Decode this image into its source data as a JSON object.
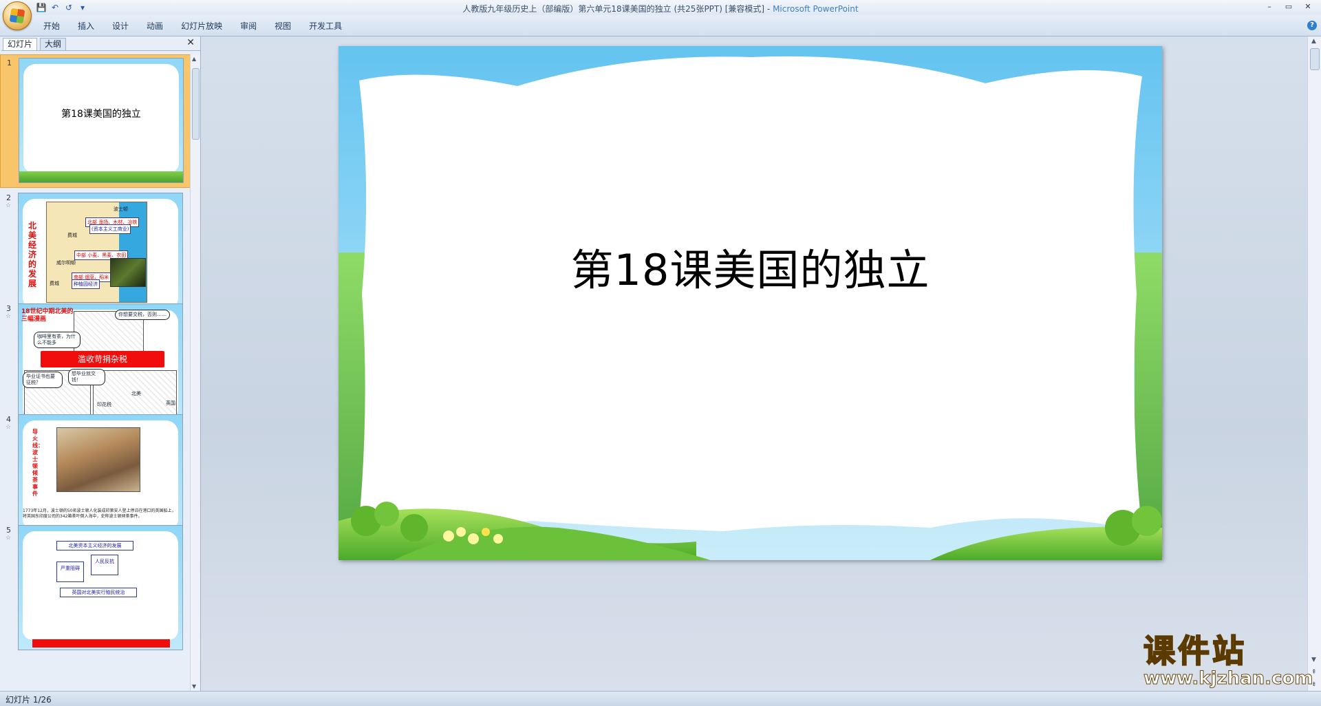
{
  "window": {
    "title": "人教版九年级历史上（部编版）第六单元18课美国的独立 (共25张PPT) [兼容模式]",
    "separator": " - ",
    "app_name": "Microsoft PowerPoint"
  },
  "quick_access": {
    "save": "💾",
    "undo": "↶",
    "redo": "↺",
    "more": "▾"
  },
  "window_controls": {
    "minimize": "–",
    "restore": "▭",
    "close": "✕"
  },
  "ribbon": {
    "tabs": [
      "开始",
      "插入",
      "设计",
      "动画",
      "幻灯片放映",
      "审阅",
      "视图",
      "开发工具"
    ],
    "help": "?"
  },
  "left_pane": {
    "tab_slides": "幻灯片",
    "tab_outline": "大纲",
    "close": "✕"
  },
  "thumbnails": [
    {
      "number": "1",
      "title": "第18课美国的独立",
      "selected": true
    },
    {
      "number": "2",
      "star": "☆",
      "vertical_title": "北美经济的发展",
      "labels": [
        "波士顿",
        "北部 渔场、木材、冶铁",
        "(资本主义工商业)",
        "费城",
        "中部 小麦、黑麦、农田",
        "威尔明顿",
        "南部 烟草、稻米",
        "种植园经济",
        "费城"
      ]
    },
    {
      "number": "3",
      "star": "☆",
      "title": "18世纪中期北美的三幅漫画",
      "bubbles": [
        "你想要交税，否则……",
        "咖啡里有茶，为什么不能多",
        "毕业证书也要征税？",
        "想毕业就交钱！"
      ],
      "banner": "滥收苛捐杂税",
      "captions": [
        "印花税",
        "北美",
        "英国"
      ]
    },
    {
      "number": "4",
      "star": "☆",
      "vertical_title": "导火线：波士顿倾茶事件",
      "text": "1773年12月，波士顿的50名波士顿人化装成印第安人登上停泊在港口的英国船上，将英国东印度公司的342箱茶叶倒入海中，史称波士顿倾茶事件。"
    },
    {
      "number": "5",
      "star": "☆",
      "boxes": [
        "北美资本主义经济的发展",
        "严重阻碍",
        "人民反抗",
        "英国对北美实行殖民统治"
      ]
    }
  ],
  "slide": {
    "title": "第18课美国的独立"
  },
  "watermark": {
    "text": "课件站",
    "url": "www.kjzhan.com"
  },
  "status": {
    "slide_indicator": "幻灯片 1/26"
  },
  "colors": {
    "sky": "#64c3f0",
    "grass": "#5cb82e",
    "selection": "#f9c56a",
    "accent_red": "#f20d0d"
  }
}
